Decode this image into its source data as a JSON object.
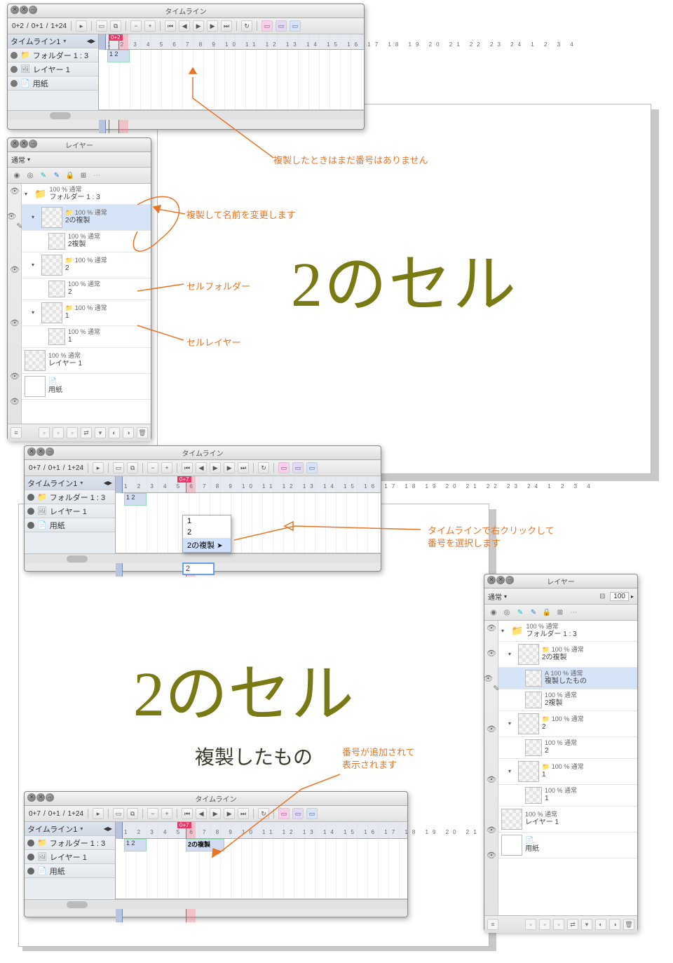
{
  "panels": {
    "timeline_title": "タイムライン",
    "layer_title": "レイヤー"
  },
  "timeline1": {
    "counter_left": "0+2",
    "counter_mid": "0+1",
    "fps": "1+24",
    "redflag": "0+2",
    "tab": "タイムライン1",
    "tracks": {
      "folder": "フォルダー 1 : 3",
      "layer": "レイヤー 1",
      "paper": "用紙"
    },
    "celnums": "1  2"
  },
  "timeline2": {
    "counter_left": "0+7",
    "counter_mid": "0+1",
    "fps": "1+24",
    "redflag": "0+7",
    "tab": "タイムライン1",
    "tracks": {
      "folder": "フォルダー 1 : 3",
      "layer": "レイヤー 1",
      "paper": "用紙"
    },
    "celnums": "1  2"
  },
  "timeline3": {
    "counter_left": "0+7",
    "counter_mid": "0+1",
    "fps": "1+24",
    "redflag": "0+7",
    "tab": "タイムライン1",
    "tracks": {
      "folder": "フォルダー 1 : 3",
      "layer": "レイヤー 1",
      "paper": "用紙"
    },
    "celnums": "1  2",
    "celdup": "2の複製"
  },
  "ctx_menu": {
    "i1": "1",
    "i2": "2",
    "i3": "2の複製",
    "input": "2"
  },
  "layer_panel1": {
    "mode": "通常",
    "opacity": "100 % 通常",
    "rows": [
      {
        "opa": "100 % 通常",
        "name": "フォルダー 1 : 3"
      },
      {
        "opa": "100 % 通常",
        "name": "2の複製"
      },
      {
        "opa": "100 % 通常",
        "name": "2複製"
      },
      {
        "opa": "100 % 通常",
        "name": "2"
      },
      {
        "opa": "100 % 通常",
        "name": "2"
      },
      {
        "opa": "100 % 通常",
        "name": "1"
      },
      {
        "opa": "100 % 通常",
        "name": "1"
      },
      {
        "opa": "100 % 通常",
        "name": "レイヤー 1"
      },
      {
        "name": "用紙"
      }
    ]
  },
  "layer_panel2": {
    "mode": "通常",
    "opa_field": "100",
    "rows": [
      {
        "opa": "100 % 通常",
        "name": "フォルダー 1 : 3"
      },
      {
        "opa": "100 % 通常",
        "name": "2の複製"
      },
      {
        "opa": "100 % 通常",
        "name": "複製したもの"
      },
      {
        "opa": "100 % 通常",
        "name": "2複製"
      },
      {
        "opa": "100 % 通常",
        "name": "2"
      },
      {
        "opa": "100 % 通常",
        "name": "2"
      },
      {
        "opa": "100 % 通常",
        "name": "1"
      },
      {
        "opa": "100 % 通常",
        "name": "1"
      },
      {
        "opa": "100 % 通常",
        "name": "レイヤー 1"
      },
      {
        "name": "用紙"
      }
    ]
  },
  "annotations": {
    "a1": "複製したときはまだ番号はありません",
    "a2": "複製して名前を変更します",
    "a3": "セルフォルダー",
    "a4": "セルレイヤー",
    "a5_l1": "タイムラインで右クリックして",
    "a5_l2": "番号を選択します",
    "a6_l1": "番号が追加されて",
    "a6_l2": "表示されます"
  },
  "handwritten": {
    "cell2": "2のセル",
    "cell2b": "2のセル",
    "dup": "複製したもの"
  }
}
